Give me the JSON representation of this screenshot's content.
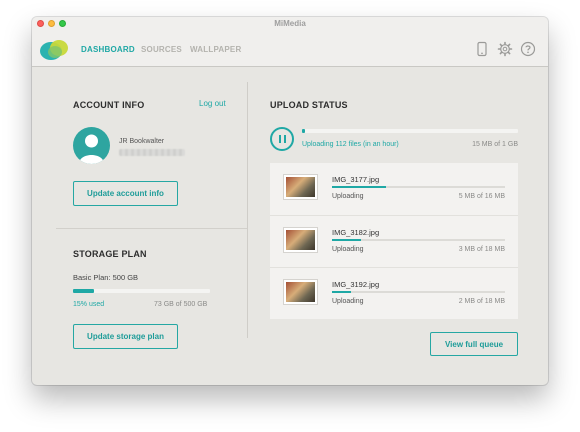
{
  "app": {
    "title": "MiMedia"
  },
  "nav": {
    "tabs": [
      {
        "label": "DASHBOARD",
        "active": true
      },
      {
        "label": "SOURCES",
        "active": false
      },
      {
        "label": "WALLPAPER",
        "active": false
      }
    ],
    "icons": [
      "phone-icon",
      "gear-icon",
      "help-icon"
    ]
  },
  "account": {
    "title": "ACCOUNT INFO",
    "logout_label": "Log out",
    "user_name": "JR Bookwalter",
    "update_button": "Update account info"
  },
  "storage": {
    "title": "STORAGE PLAN",
    "plan_label": "Basic Plan: 500 GB",
    "used_fraction": 0.15,
    "used_label": "15% used",
    "usage_label": "73 GB of 500 GB",
    "update_button": "Update storage plan"
  },
  "upload": {
    "title": "UPLOAD STATUS",
    "summary": "Uploading 112 files (in an hour)",
    "size": "15 MB of 1 GB",
    "overall_fraction": 0.015,
    "items": [
      {
        "name": "IMG_3177.jpg",
        "status": "Uploading",
        "size": "5 MB of 16 MB",
        "progress": 0.31
      },
      {
        "name": "IMG_3182.jpg",
        "status": "Uploading",
        "size": "3 MB of 18 MB",
        "progress": 0.17
      },
      {
        "name": "IMG_3192.jpg",
        "status": "Uploading",
        "size": "2 MB of 18 MB",
        "progress": 0.11
      }
    ],
    "view_queue_button": "View full queue"
  },
  "colors": {
    "accent": "#1fa8a5",
    "background": "#e7e6e2"
  }
}
